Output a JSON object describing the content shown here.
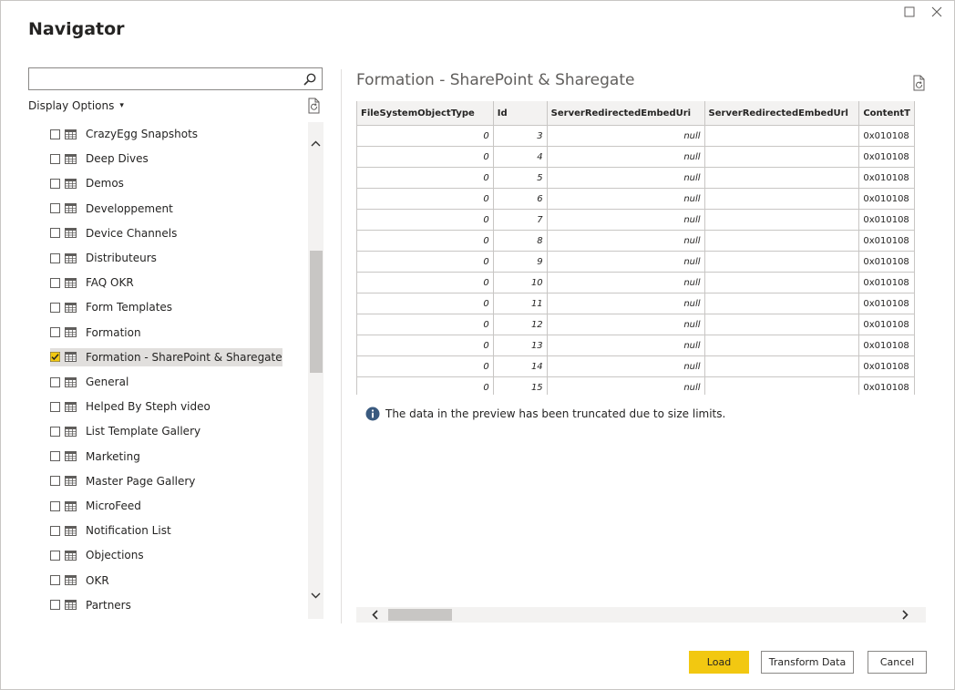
{
  "window": {
    "title": "Navigator",
    "restore_icon": "restore-icon",
    "close_icon": "close-icon"
  },
  "search": {
    "value": "",
    "placeholder": ""
  },
  "display_options": {
    "label": "Display Options",
    "caret": "▾"
  },
  "nav_items": [
    {
      "label": "CrazyEgg Snapshots",
      "checked": false
    },
    {
      "label": "Deep Dives",
      "checked": false
    },
    {
      "label": "Demos",
      "checked": false
    },
    {
      "label": "Developpement",
      "checked": false
    },
    {
      "label": "Device Channels",
      "checked": false
    },
    {
      "label": "Distributeurs",
      "checked": false
    },
    {
      "label": "FAQ OKR",
      "checked": false
    },
    {
      "label": "Form Templates",
      "checked": false
    },
    {
      "label": "Formation",
      "checked": false
    },
    {
      "label": "Formation - SharePoint & Sharegate",
      "checked": true,
      "selected": true
    },
    {
      "label": "General",
      "checked": false
    },
    {
      "label": "Helped By Steph video",
      "checked": false
    },
    {
      "label": "List Template Gallery",
      "checked": false
    },
    {
      "label": "Marketing",
      "checked": false
    },
    {
      "label": "Master Page Gallery",
      "checked": false
    },
    {
      "label": "MicroFeed",
      "checked": false
    },
    {
      "label": "Notification List",
      "checked": false
    },
    {
      "label": "Objections",
      "checked": false
    },
    {
      "label": "OKR",
      "checked": false
    },
    {
      "label": "Partners",
      "checked": false
    }
  ],
  "preview": {
    "title": "Formation - SharePoint & Sharegate",
    "columns": [
      "FileSystemObjectType",
      "Id",
      "ServerRedirectedEmbedUri",
      "ServerRedirectedEmbedUrl",
      "ContentT"
    ],
    "rows": [
      [
        "0",
        "3",
        "null",
        "",
        "0x010108"
      ],
      [
        "0",
        "4",
        "null",
        "",
        "0x010108"
      ],
      [
        "0",
        "5",
        "null",
        "",
        "0x010108"
      ],
      [
        "0",
        "6",
        "null",
        "",
        "0x010108"
      ],
      [
        "0",
        "7",
        "null",
        "",
        "0x010108"
      ],
      [
        "0",
        "8",
        "null",
        "",
        "0x010108"
      ],
      [
        "0",
        "9",
        "null",
        "",
        "0x010108"
      ],
      [
        "0",
        "10",
        "null",
        "",
        "0x010108"
      ],
      [
        "0",
        "11",
        "null",
        "",
        "0x010108"
      ],
      [
        "0",
        "12",
        "null",
        "",
        "0x010108"
      ],
      [
        "0",
        "13",
        "null",
        "",
        "0x010108"
      ],
      [
        "0",
        "14",
        "null",
        "",
        "0x010108"
      ],
      [
        "0",
        "15",
        "null",
        "",
        "0x010108"
      ]
    ],
    "info_text": "The data in the preview has been truncated due to size limits."
  },
  "buttons": {
    "load": "Load",
    "transform": "Transform Data",
    "cancel": "Cancel"
  },
  "colors": {
    "accent": "#f2c811",
    "info_icon": "#3a5a7f"
  }
}
